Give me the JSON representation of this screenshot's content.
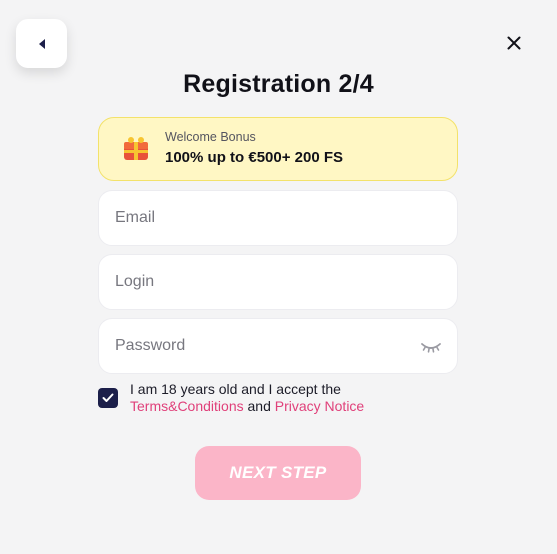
{
  "header": {
    "title": "Registration 2/4",
    "back_icon": "chevron-left-icon",
    "close_icon": "close-icon"
  },
  "bonus": {
    "label": "Welcome Bonus",
    "value": "100% up to €500+ 200 FS",
    "icon": "gift-chest-icon"
  },
  "form": {
    "email_placeholder": "Email",
    "login_placeholder": "Login",
    "password_placeholder": "Password",
    "password_toggle_icon": "eye-closed-icon",
    "consent": {
      "checked": true,
      "text": "I am 18 years old and I accept the",
      "terms_link": "Terms&Conditions",
      "and": "and",
      "privacy_link": "Privacy Notice"
    }
  },
  "actions": {
    "next_label": "NEXT STEP"
  },
  "colors": {
    "accent_pink": "#e0407a",
    "button_pink": "#fbb5c8",
    "bonus_bg": "#fff7c4",
    "checkbox_navy": "#1c1f4a"
  }
}
